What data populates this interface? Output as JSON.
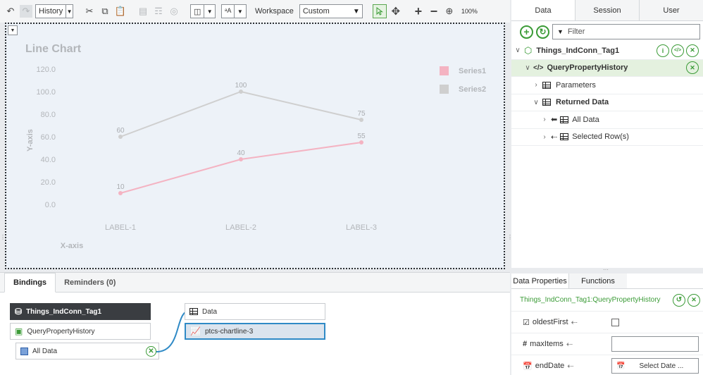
{
  "toolbar": {
    "history_label": "History",
    "workspace_label": "Workspace",
    "workspace_value": "Custom",
    "zoom": "100%"
  },
  "chart_data": {
    "type": "line",
    "title": "Line Chart",
    "xlabel": "X-axis",
    "ylabel": "Y-axis",
    "categories": [
      "LABEL-1",
      "LABEL-2",
      "LABEL-3"
    ],
    "series": [
      {
        "name": "Series1",
        "values": [
          10,
          40,
          55
        ],
        "color": "#f4b3c2"
      },
      {
        "name": "Series2",
        "values": [
          60,
          100,
          75
        ],
        "color": "#cfcfcf"
      }
    ],
    "yticks": [
      "120.0",
      "100.0",
      "80.0",
      "60.0",
      "40.0",
      "20.0",
      "0.0"
    ],
    "ylim": [
      0,
      120
    ],
    "legend": "top-right",
    "grid": false
  },
  "bindings": {
    "tabs": [
      "Bindings",
      "Reminders (0)"
    ],
    "source_thing": "Things_IndConn_Tag1",
    "source_service": "QueryPropertyHistory",
    "source_output": "All Data",
    "target_prop": "Data",
    "target_widget": "ptcs-chartline-3"
  },
  "right_panel": {
    "tabs": [
      "Data",
      "Session",
      "User"
    ],
    "filter_placeholder": "Filter",
    "tree": {
      "thing": "Things_IndConn_Tag1",
      "service": "QueryPropertyHistory",
      "parameters": "Parameters",
      "returned": "Returned Data",
      "all_data": "All Data",
      "selected_rows": "Selected Row(s)"
    }
  },
  "data_props": {
    "tabs": [
      "Data Properties",
      "Functions"
    ],
    "path": "Things_IndConn_Tag1:QueryPropertyHistory",
    "rows": [
      {
        "name": "oldestFirst"
      },
      {
        "name": "maxItems"
      },
      {
        "name": "endDate",
        "value": "Select Date ..."
      }
    ]
  }
}
